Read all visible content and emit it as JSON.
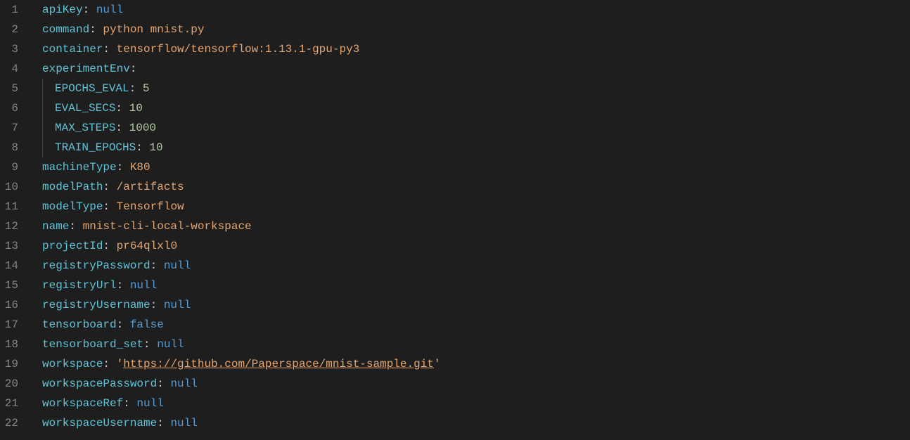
{
  "lines": [
    {
      "n": 1,
      "indent": 0,
      "key": "apiKey",
      "sep": ": ",
      "val": "null",
      "vclass": "null"
    },
    {
      "n": 2,
      "indent": 0,
      "key": "command",
      "sep": ": ",
      "val": "python mnist.py",
      "vclass": "str"
    },
    {
      "n": 3,
      "indent": 0,
      "key": "container",
      "sep": ": ",
      "val": "tensorflow/tensorflow:1.13.1-gpu-py3",
      "vclass": "str"
    },
    {
      "n": 4,
      "indent": 0,
      "key": "experimentEnv",
      "sep": ":",
      "val": "",
      "vclass": ""
    },
    {
      "n": 5,
      "indent": 1,
      "key": "EPOCHS_EVAL",
      "sep": ": ",
      "val": "5",
      "vclass": "num"
    },
    {
      "n": 6,
      "indent": 1,
      "key": "EVAL_SECS",
      "sep": ": ",
      "val": "10",
      "vclass": "num"
    },
    {
      "n": 7,
      "indent": 1,
      "key": "MAX_STEPS",
      "sep": ": ",
      "val": "1000",
      "vclass": "num"
    },
    {
      "n": 8,
      "indent": 1,
      "key": "TRAIN_EPOCHS",
      "sep": ": ",
      "val": "10",
      "vclass": "num"
    },
    {
      "n": 9,
      "indent": 0,
      "key": "machineType",
      "sep": ": ",
      "val": "K80",
      "vclass": "str"
    },
    {
      "n": 10,
      "indent": 0,
      "key": "modelPath",
      "sep": ": ",
      "val": "/artifacts",
      "vclass": "str"
    },
    {
      "n": 11,
      "indent": 0,
      "key": "modelType",
      "sep": ": ",
      "val": "Tensorflow",
      "vclass": "str"
    },
    {
      "n": 12,
      "indent": 0,
      "key": "name",
      "sep": ": ",
      "val": "mnist-cli-local-workspace",
      "vclass": "str"
    },
    {
      "n": 13,
      "indent": 0,
      "key": "projectId",
      "sep": ": ",
      "val": "pr64qlxl0",
      "vclass": "str"
    },
    {
      "n": 14,
      "indent": 0,
      "key": "registryPassword",
      "sep": ": ",
      "val": "null",
      "vclass": "null"
    },
    {
      "n": 15,
      "indent": 0,
      "key": "registryUrl",
      "sep": ": ",
      "val": "null",
      "vclass": "null"
    },
    {
      "n": 16,
      "indent": 0,
      "key": "registryUsername",
      "sep": ": ",
      "val": "null",
      "vclass": "null"
    },
    {
      "n": 17,
      "indent": 0,
      "key": "tensorboard",
      "sep": ": ",
      "val": "false",
      "vclass": "bool"
    },
    {
      "n": 18,
      "indent": 0,
      "key": "tensorboard_set",
      "sep": ": ",
      "val": "null",
      "vclass": "null"
    },
    {
      "n": 19,
      "indent": 0,
      "key": "workspace",
      "sep": ": ",
      "val": "https://github.com/Paperspace/mnist-sample.git",
      "vclass": "str",
      "quoted": true,
      "link": true
    },
    {
      "n": 20,
      "indent": 0,
      "key": "workspacePassword",
      "sep": ": ",
      "val": "null",
      "vclass": "null"
    },
    {
      "n": 21,
      "indent": 0,
      "key": "workspaceRef",
      "sep": ": ",
      "val": "null",
      "vclass": "null"
    },
    {
      "n": 22,
      "indent": 0,
      "key": "workspaceUsername",
      "sep": ": ",
      "val": "null",
      "vclass": "null"
    }
  ]
}
